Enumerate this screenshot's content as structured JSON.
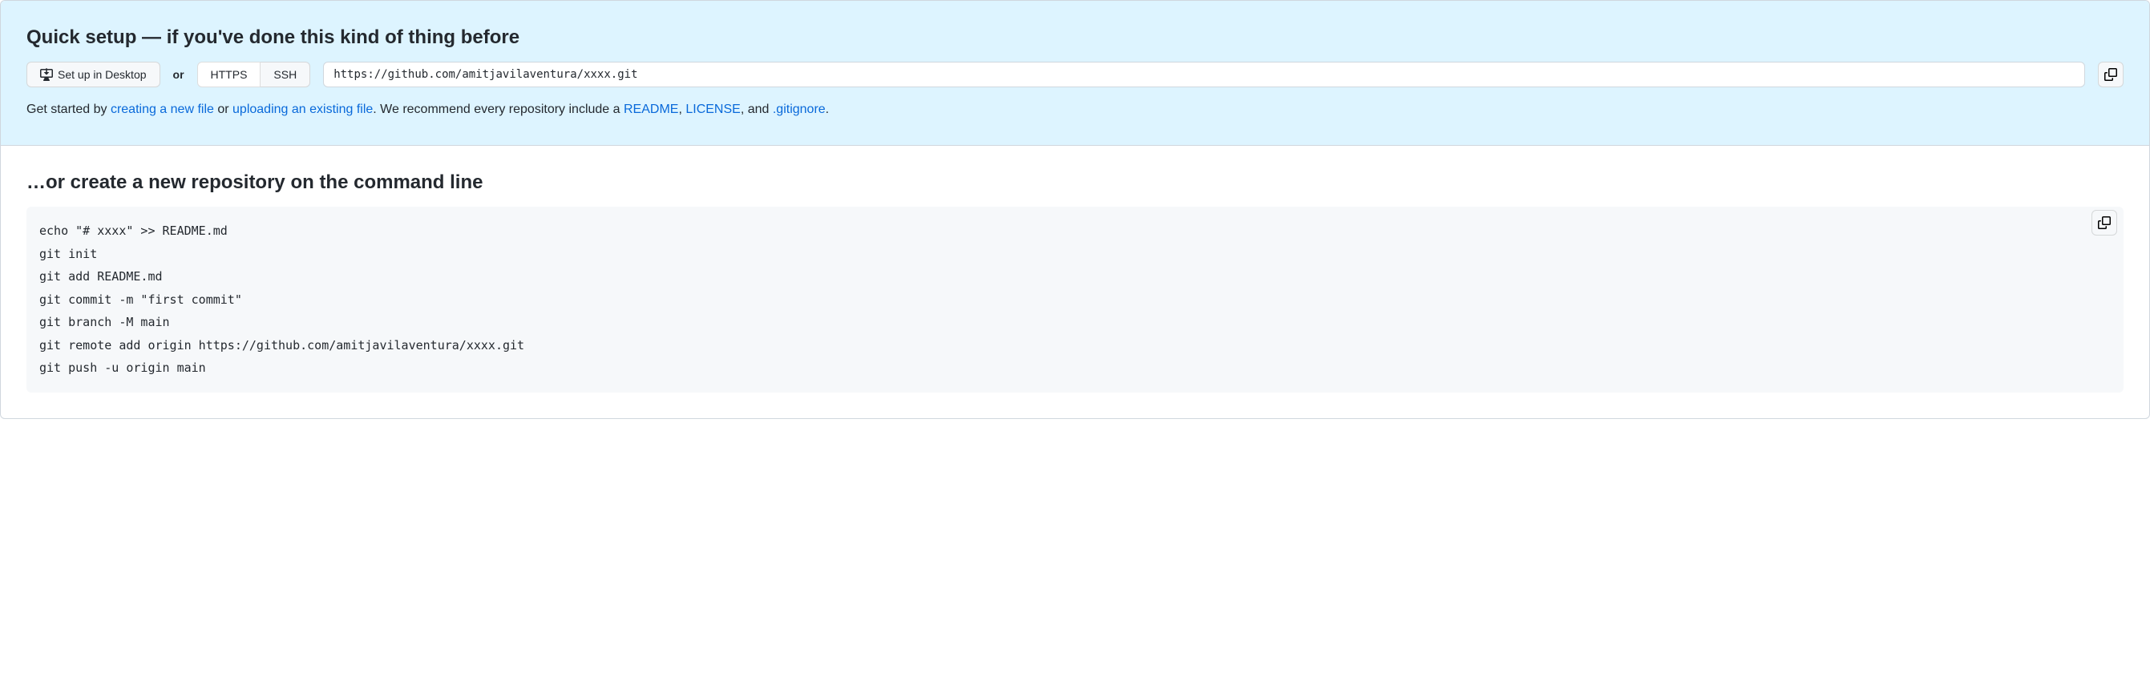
{
  "quick_setup": {
    "title": "Quick setup — if you've done this kind of thing before",
    "desktop_button": "Set up in Desktop",
    "or_text": "or",
    "protocol_https": "HTTPS",
    "protocol_ssh": "SSH",
    "clone_url": "https://github.com/amitjavilaventura/xxxx.git",
    "help": {
      "prefix": "Get started by ",
      "link_new_file": "creating a new file",
      "mid1": " or ",
      "link_upload": "uploading an existing file",
      "mid2": ". We recommend every repository include a ",
      "link_readme": "README",
      "mid3": ", ",
      "link_license": "LICENSE",
      "mid4": ", and ",
      "link_gitignore": ".gitignore",
      "suffix": "."
    }
  },
  "command_line": {
    "title": "…or create a new repository on the command line",
    "code": "echo \"# xxxx\" >> README.md\ngit init\ngit add README.md\ngit commit -m \"first commit\"\ngit branch -M main\ngit remote add origin https://github.com/amitjavilaventura/xxxx.git\ngit push -u origin main"
  }
}
